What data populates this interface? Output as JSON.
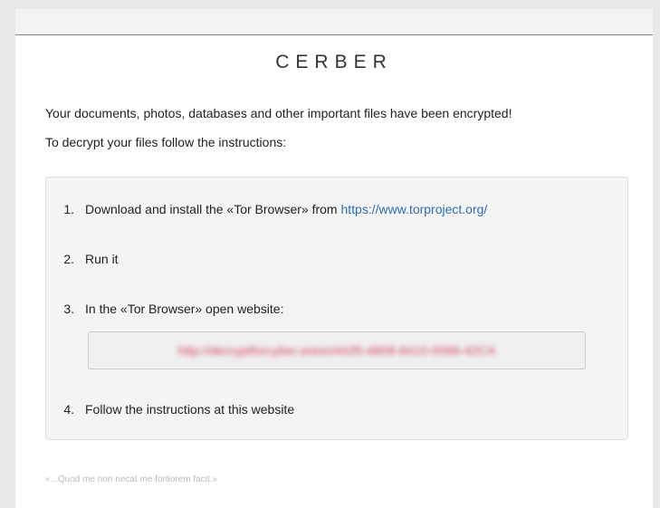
{
  "title": "CERBER",
  "intro": {
    "line1": "Your documents, photos, databases and other important files have been encrypted!",
    "line2": "To decrypt your files follow the instructions:"
  },
  "steps": [
    {
      "num": "1.",
      "text": "Download and install the «Tor Browser» from ",
      "link": "https://www.torproject.org/"
    },
    {
      "num": "2.",
      "text": "Run it"
    },
    {
      "num": "3.",
      "text": "In the «Tor Browser» open website:"
    },
    {
      "num": "4.",
      "text": "Follow the instructions at this website"
    }
  ],
  "url_field": {
    "value": "http://decryptforcyber.onion/4435-4808-8410-0096-42CA",
    "obscured": true,
    "text_color": "#d9445e"
  },
  "footer_quote": "«...Quod me non necat me fortiorem facit.»",
  "colors": {
    "link": "#2a6db5",
    "background": "#e8e8e8",
    "box": "#f4f4f4"
  }
}
